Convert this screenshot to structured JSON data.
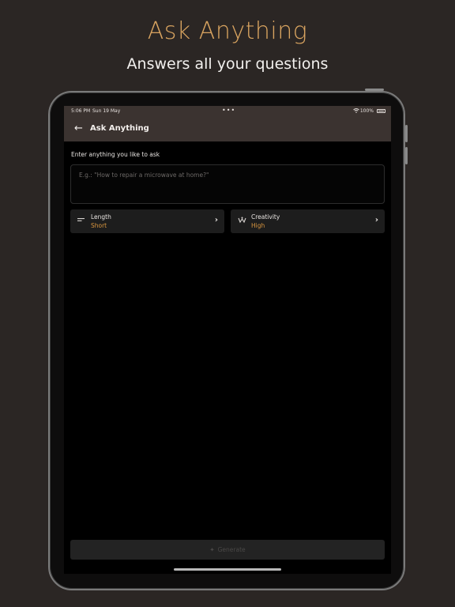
{
  "promo": {
    "title": "Ask Anything",
    "subtitle": "Answers all your questions"
  },
  "statusbar": {
    "time": "5:06 PM",
    "date": "Sun 19 May",
    "dots": "•••",
    "battery_pct": "100%",
    "wifi_icon": "wifi-icon",
    "battery_icon": "battery-icon"
  },
  "navbar": {
    "back_glyph": "←",
    "title": "Ask Anything"
  },
  "form": {
    "prompt_label": "Enter anything you like to ask",
    "placeholder": "E.g.: \"How to repair a microwave at home?\"",
    "value": ""
  },
  "options": {
    "length": {
      "label": "Length",
      "value": "Short",
      "icon": "length-lines-icon"
    },
    "creativity": {
      "label": "Creativity",
      "value": "High",
      "icon": "creativity-icon"
    }
  },
  "generate": {
    "label": "Generate",
    "icon": "sparkle-icon"
  },
  "colors": {
    "accent": "#d9963f",
    "promo_title": "#d9a460",
    "background": "#2b2624",
    "header": "#3b3330"
  }
}
